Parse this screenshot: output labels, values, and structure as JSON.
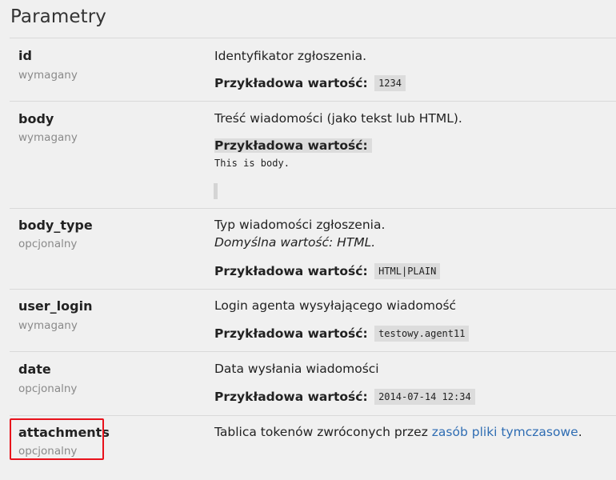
{
  "page": {
    "title": "Parametry"
  },
  "params": [
    {
      "name": "id",
      "requirement": "wymagany",
      "description": "Identyfikator zgłoszenia.",
      "example_label": "Przykładowa wartość:",
      "example_value": "1234"
    },
    {
      "name": "body",
      "requirement": "wymagany",
      "description": "Treść wiadomości (jako tekst lub HTML).",
      "example_label": "Przykładowa wartość:",
      "example_value": "This is body."
    },
    {
      "name": "body_type",
      "requirement": "opcjonalny",
      "description": "Typ wiadomości zgłoszenia.",
      "default": "Domyślna wartość: HTML.",
      "example_label": "Przykładowa wartość:",
      "example_value": "HTML|PLAIN"
    },
    {
      "name": "user_login",
      "requirement": "wymagany",
      "description": "Login agenta wysyłającego wiadomość",
      "example_label": "Przykładowa wartość:",
      "example_value": "testowy.agent11"
    },
    {
      "name": "date",
      "requirement": "opcjonalny",
      "description": "Data wysłania wiadomości",
      "example_label": "Przykładowa wartość:",
      "example_value": "2014-07-14 12:34"
    },
    {
      "name": "attachments",
      "requirement": "opcjonalny",
      "description_prefix": "Tablica tokenów zwróconych przez ",
      "description_link": "zasób pliki tymczasowe",
      "description_suffix": "."
    }
  ],
  "colors": {
    "highlight": "#e8121b",
    "link": "#2f6db3"
  }
}
